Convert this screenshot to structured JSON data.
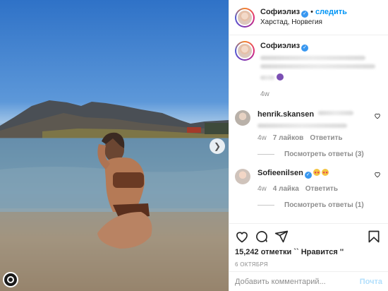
{
  "post": {
    "username": "Софиэлиз",
    "separator": "•",
    "follow_label": "следить",
    "location": "Харстад, Норвегия",
    "caption_time": "4w",
    "accent_color": "#0095f6",
    "verified_color": "#3897f0"
  },
  "comments": [
    {
      "username": "henrik.skansen",
      "time": "4w",
      "likes": "7 лайков",
      "reply_label": "Ответить",
      "view_replies": "Посмотреть ответы (3)"
    },
    {
      "username": "Sofieenilsen",
      "time": "4w",
      "likes": "4 лайка",
      "reply_label": "Ответить",
      "view_replies": "Посмотреть ответы (1)",
      "emoji": [
        "heart-eyes",
        "heart-eyes"
      ]
    }
  ],
  "footer": {
    "like_count": "15,242 отметки `` Нравится ''",
    "date": "6 ОКТЯБРЯ",
    "comment_placeholder": "Добавить комментарий...",
    "post_label": "Почта"
  },
  "icons": [
    "heart-icon",
    "comment-icon",
    "share-icon",
    "bookmark-icon",
    "next-arrow-icon",
    "verified-badge-icon"
  ]
}
